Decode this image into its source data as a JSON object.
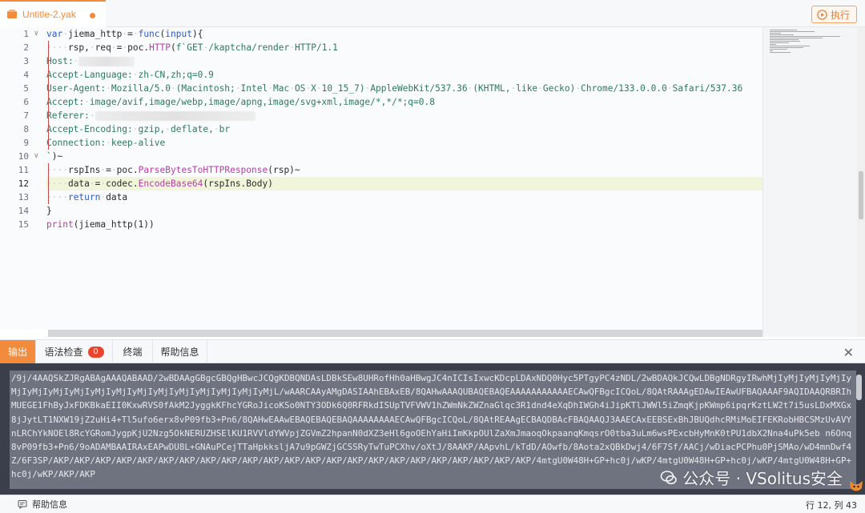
{
  "tab": {
    "title": "Untitle-2.yak"
  },
  "toolbar": {
    "run_label": "执行"
  },
  "editor": {
    "lines": [
      {
        "n": "1",
        "fold": "∨",
        "html": "<span class=\"kw\">var</span><span class=\"ws\">·</span><span class=\"pl\">jiema_http</span><span class=\"ws\">·</span><span class=\"pl\">=</span><span class=\"ws\">·</span><span class=\"kw\">func</span><span class=\"pl\">(</span><span class=\"kw\">input</span><span class=\"pl\">){</span>"
      },
      {
        "n": "2",
        "fold": "",
        "html": "<span class=\"ws\">····</span><span class=\"pl\">rsp,</span><span class=\"ws\">·</span><span class=\"pl\">req</span><span class=\"ws\">·</span><span class=\"pl\">=</span><span class=\"ws\">·</span><span class=\"pl\">poc.</span><span class=\"fn\">HTTP</span><span class=\"pl\">(</span><span class=\"st\">f`GET</span><span class=\"ws\">·</span><span class=\"st\">/kaptcha/render</span><span class=\"ws\">·</span><span class=\"st\">HTTP/1.1</span>"
      },
      {
        "n": "3",
        "fold": "",
        "html": "<span class=\"st\">Host:</span><span class=\"ws\">·</span><span class=\"blur\" style=\"width:70px\"></span>"
      },
      {
        "n": "4",
        "fold": "",
        "html": "<span class=\"st\">Accept-Language:</span><span class=\"ws\">·</span><span class=\"st\">zh-CN,zh;q=0.9</span>"
      },
      {
        "n": "5",
        "fold": "",
        "html": "<span class=\"st\">User-Agent:</span><span class=\"ws\">·</span><span class=\"st\">Mozilla/5.0</span><span class=\"ws\">·</span><span class=\"st\">(Macintosh;</span><span class=\"ws\">·</span><span class=\"st\">Intel</span><span class=\"ws\">·</span><span class=\"st\">Mac</span><span class=\"ws\">·</span><span class=\"st\">OS</span><span class=\"ws\">·</span><span class=\"st\">X</span><span class=\"ws\">·</span><span class=\"st\">10_15_7)</span><span class=\"ws\">·</span><span class=\"st\">AppleWebKit/537.36</span><span class=\"ws\">·</span><span class=\"st\">(KHTML,</span><span class=\"ws\">·</span><span class=\"st\">like</span><span class=\"ws\">·</span><span class=\"st\">Gecko)</span><span class=\"ws\">·</span><span class=\"st\">Chrome/133.0.0.0</span><span class=\"ws\">·</span><span class=\"st\">Safari/537.36</span>"
      },
      {
        "n": "6",
        "fold": "",
        "html": "<span class=\"st\">Accept:</span><span class=\"ws\">·</span><span class=\"st\">image/avif,image/webp,image/apng,image/svg+xml,image/*,*/*;q=0.8</span>"
      },
      {
        "n": "7",
        "fold": "",
        "html": "<span class=\"st\">Referer:</span><span class=\"ws\">·</span><span class=\"blur\" style=\"width:200px\"></span>"
      },
      {
        "n": "8",
        "fold": "",
        "html": "<span class=\"st\">Accept-Encoding:</span><span class=\"ws\">·</span><span class=\"st\">gzip,</span><span class=\"ws\">·</span><span class=\"st\">deflate,</span><span class=\"ws\">·</span><span class=\"st\">br</span>"
      },
      {
        "n": "9",
        "fold": "",
        "html": "<span class=\"st\">Connection:</span><span class=\"ws\">·</span><span class=\"st\">keep-alive</span>"
      },
      {
        "n": "10",
        "fold": "∨",
        "html": "<span class=\"st\">`</span><span class=\"pl\">)~</span>"
      },
      {
        "n": "11",
        "fold": "",
        "html": "<span class=\"ws\">····</span><span class=\"pl\">rspIns</span><span class=\"ws\">·</span><span class=\"pl\">=</span><span class=\"ws\">·</span><span class=\"pl\">poc.</span><span class=\"fn\">ParseBytesToHTTPResponse</span><span class=\"pl\">(rsp)~</span>"
      },
      {
        "n": "12",
        "fold": "",
        "html": "<span class=\"ws\">····</span><span class=\"pl\">data</span><span class=\"ws\">·</span><span class=\"pl\">=</span><span class=\"ws\">·</span><span class=\"pl\">codec.</span><span class=\"fn\">EncodeBase64</span><span class=\"pl\">(rspIns.Body)</span>"
      },
      {
        "n": "13",
        "fold": "",
        "html": "<span class=\"ws\">····</span><span class=\"kw\">return</span><span class=\"ws\">·</span><span class=\"pl\">data</span>"
      },
      {
        "n": "14",
        "fold": "",
        "html": "<span class=\"pl\">}</span>"
      },
      {
        "n": "15",
        "fold": "",
        "html": "<span class=\"fn\">print</span><span class=\"pl\">(jiema_http(1))</span>"
      }
    ],
    "active_line": 12
  },
  "panel": {
    "tabs": [
      {
        "label": "输出",
        "active": true,
        "badge": ""
      },
      {
        "label": "语法检查",
        "active": false,
        "badge": "0"
      },
      {
        "label": "终端",
        "active": false,
        "badge": ""
      },
      {
        "label": "帮助信息",
        "active": false,
        "badge": ""
      }
    ],
    "output": "/9j/4AAQSkZJRgABAgAAAQABAAD/2wBDAAgGBgcGBQgHBwcJCQgKDBQNDAsLDBkSEw8UHRofHh0aHBwgJC4nICIsIxwcKDcpLDAxNDQ0Hyc5PTgyPC4zNDL/2wBDAQkJCQwLDBgNDRgyIRwhMjIyMjIyMjIyMjIyMjIyMjIyMjIyMjIyMjIyMjIyMjIyMjIyMjIyMjIyMjIyMjIyMjL/wAARCAAyAMgDASIAAhEBAxEB/8QAHwAAAQUBAQEBAQEAAAAAAAAAAAECAwQFBgcICQoL/8QAtRAAAgEDAwIEAwUFBAQAAAF9AQIDAAQRBRIhMUEGE1FhByJxFDKBkaEII0KxwRVS0fAkM2JyggkKFhcYGRoJicoKSo0NTY3ODk6Q0RFRkdISUpTVFVWV1hZWmNkZWZnaGlqc3R1dnd4eXqDhIWGh4iJipKTlJWWl5iZmqKjpKWmp6ipqrKztLW2t7i5usLDxMXGx8jJytLT1NXW19jZ2uHi4+Tl5ufo6erx8vP09fb3+Pn6/8QAHwEAAwEBAQEBAQEBAQAAAAAAAAECAwQFBgcICQoL/8QAtREAAgECBAQDBAcFBAQAAQJ3AAECAxEEBSExBhJBUQdhcRMiMoEIFEKRobHBCSMzUvAVYnLRChYkNOEl8RcYGRomJygpKjU2Nzg5OkNERUZHSElKU1RVVldYWVpjZGVmZ2hpanN0dXZ3eHl6goOEhYaHiImKkpOUlZaXmJmaoqOkpaanqKmqsrO0tba3uLm6wsPExcbHyMnK0tPU1dbX2Nna4uPk5eb n6Onq8vP09fb3+Pn6/9oADAMBAAIRAxEAPwDU8L+GNAuPCejTTaHpkksljA7u9pGWZjGCSSRyTwTuPCXhv/oXtJ/8AAKP/AApvhL/kTdD/AOwfb/8Aota2xQBkDwj4/6F7Sf/AACj/wDiacPCPhu0PjSMAo/wD4mnDwf4Z/6F3SP/AKP/AKP/AKP/AKP/AKP/AKP/AKP/AKP/AKP/AKP/AKP/AKP/AKP/AKP/AKP/AKP/AKP/AKP/AKP/AKP/AKP/AKP/AKP/4mtgU0W48H+GP+hc0j/wKP/4mtgU0W48H+GP+hc0j/wKP/4mtgU0W48H+GP+hc0j/wKP/AKP/AKP"
  },
  "status": {
    "help_label": "帮助信息",
    "cursor": "行 12, 列 43"
  },
  "watermark": "公众号 · VSolitus安全",
  "colors": {
    "accent": "#f28b3c",
    "badge": "#e8452c",
    "output_bg": "#6f7380"
  }
}
